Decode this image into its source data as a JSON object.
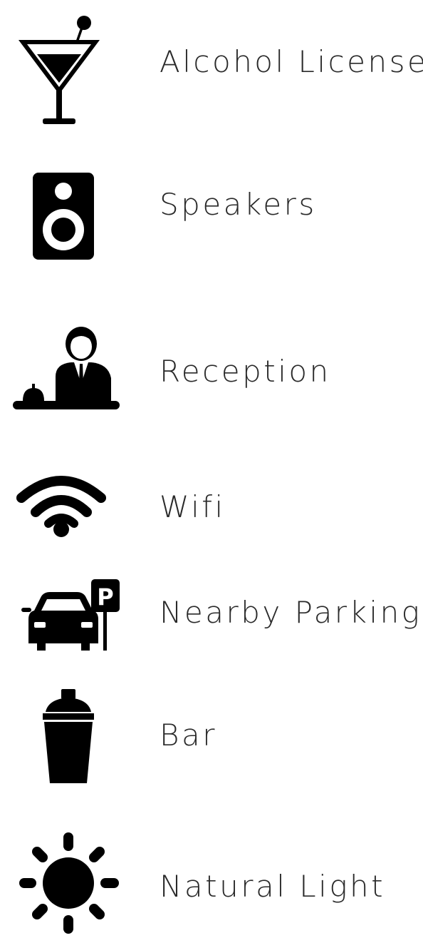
{
  "amenities": [
    {
      "icon": "cocktail-glass-icon",
      "label": "Alcohol License"
    },
    {
      "icon": "speaker-icon",
      "label": "Speakers"
    },
    {
      "icon": "receptionist-icon",
      "label": "Reception"
    },
    {
      "icon": "wifi-icon",
      "label": "Wifi"
    },
    {
      "icon": "car-parking-icon",
      "label": "Nearby Parking"
    },
    {
      "icon": "cocktail-shaker-icon",
      "label": "Bar"
    },
    {
      "icon": "sun-icon",
      "label": "Natural Light"
    }
  ],
  "colors": {
    "icon": "#000000",
    "text": "#2a2a2a",
    "background": "#ffffff"
  }
}
